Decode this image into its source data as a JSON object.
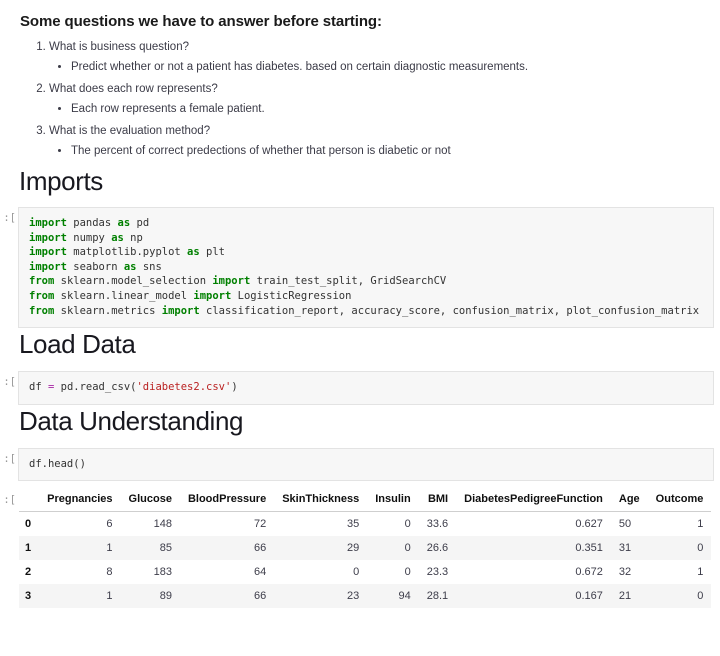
{
  "notebook": {
    "intro": {
      "title": "Some questions we have to answer before starting:",
      "items": [
        {
          "question": "What is business question?",
          "answers": [
            "Predict whether or not a patient has diabetes. based on certain diagnostic measurements."
          ]
        },
        {
          "question": "What does each row represents?",
          "answers": [
            "Each row represents a female patient."
          ]
        },
        {
          "question": "What is the evaluation method?",
          "answers": [
            "The percent of correct predections of whether that person is diabetic or not"
          ]
        }
      ]
    },
    "sections": {
      "imports_heading": "Imports",
      "load_data_heading": "Load Data",
      "data_understanding_heading": "Data Understanding"
    },
    "prompts": {
      "imports": "]:",
      "load_data": "]:",
      "head": "]:",
      "output": "]:"
    },
    "cells": {
      "imports_code_lines": [
        [
          {
            "t": "import",
            "c": "kw"
          },
          {
            "t": " pandas ",
            "c": "pn"
          },
          {
            "t": "as",
            "c": "kw"
          },
          {
            "t": " pd",
            "c": "pn"
          }
        ],
        [
          {
            "t": "import",
            "c": "kw"
          },
          {
            "t": " numpy ",
            "c": "pn"
          },
          {
            "t": "as",
            "c": "kw"
          },
          {
            "t": " np",
            "c": "pn"
          }
        ],
        [
          {
            "t": "import",
            "c": "kw"
          },
          {
            "t": " matplotlib.pyplot ",
            "c": "pn"
          },
          {
            "t": "as",
            "c": "kw"
          },
          {
            "t": " plt",
            "c": "pn"
          }
        ],
        [
          {
            "t": "import",
            "c": "kw"
          },
          {
            "t": " seaborn ",
            "c": "pn"
          },
          {
            "t": "as",
            "c": "kw"
          },
          {
            "t": " sns",
            "c": "pn"
          }
        ],
        [
          {
            "t": "from",
            "c": "kw"
          },
          {
            "t": " sklearn.model_selection ",
            "c": "pn"
          },
          {
            "t": "import",
            "c": "kw"
          },
          {
            "t": " train_test_split, GridSearchCV",
            "c": "pn"
          }
        ],
        [
          {
            "t": "from",
            "c": "kw"
          },
          {
            "t": " sklearn.linear_model ",
            "c": "pn"
          },
          {
            "t": "import",
            "c": "kw"
          },
          {
            "t": " LogisticRegression",
            "c": "pn"
          }
        ],
        [
          {
            "t": "from",
            "c": "kw"
          },
          {
            "t": " sklearn.metrics ",
            "c": "pn"
          },
          {
            "t": "import",
            "c": "kw"
          },
          {
            "t": " classification_report, accuracy_score, confusion_matrix, plot_confusion_matrix",
            "c": "pn"
          }
        ]
      ],
      "imports_code_plain": "import pandas as pd\nimport numpy as np\nimport matplotlib.pyplot as plt\nimport seaborn as sns\nfrom sklearn.model_selection import train_test_split, GridSearchCV\nfrom sklearn.linear_model import LogisticRegression\nfrom sklearn.metrics import classification_report, accuracy_score, confusion_matrix, plot_confusion_matrix",
      "load_data_code_lines": [
        [
          {
            "t": "df ",
            "c": "pn"
          },
          {
            "t": "=",
            "c": "op"
          },
          {
            "t": " pd.read_csv(",
            "c": "pn"
          },
          {
            "t": "'diabetes2.csv'",
            "c": "str"
          },
          {
            "t": ")",
            "c": "pn"
          }
        ]
      ],
      "load_data_code_plain": "df = pd.read_csv('diabetes2.csv')",
      "head_code_lines": [
        [
          {
            "t": "df.head()",
            "c": "pn"
          }
        ]
      ],
      "head_code_plain": "df.head()"
    },
    "output_table": {
      "index_header": "",
      "columns": [
        "Pregnancies",
        "Glucose",
        "BloodPressure",
        "SkinThickness",
        "Insulin",
        "BMI",
        "DiabetesPedigreeFunction",
        "Age",
        "Outcome"
      ],
      "rows": [
        {
          "index": "0",
          "values": [
            "6",
            "148",
            "72",
            "35",
            "0",
            "33.6",
            "0.627",
            "50",
            "1"
          ]
        },
        {
          "index": "1",
          "values": [
            "1",
            "85",
            "66",
            "29",
            "0",
            "26.6",
            "0.351",
            "31",
            "0"
          ]
        },
        {
          "index": "2",
          "values": [
            "8",
            "183",
            "64",
            "0",
            "0",
            "23.3",
            "0.672",
            "32",
            "1"
          ]
        },
        {
          "index": "3",
          "values": [
            "1",
            "89",
            "66",
            "23",
            "94",
            "28.1",
            "0.167",
            "21",
            "0"
          ]
        }
      ]
    },
    "colors": {
      "keyword": "#008000",
      "string": "#ba2121",
      "operator": "#a626a4",
      "cell_background": "#f7f7f7",
      "cell_border": "#e3e3e3",
      "stripe": "#f5f5f5",
      "text": "#3b3b47"
    }
  }
}
